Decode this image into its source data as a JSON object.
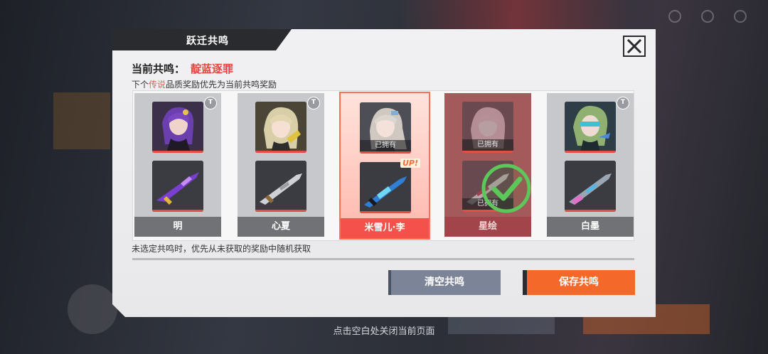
{
  "modal": {
    "title": "跃迁共鸣",
    "close_icon": "close-icon",
    "current_label": "当前共鸣：",
    "current_name": "靛蓝逐罪",
    "priority_prefix": "下个",
    "priority_legend": "传说",
    "priority_suffix": "品质奖励优先为当前共鸣奖励",
    "random_note": "未选定共鸣时，优先从未获取的奖励中随机获取",
    "clear_button": "清空共鸣",
    "save_button": "保存共鸣"
  },
  "cards": [
    {
      "name": "明",
      "badge": "T",
      "state": "default"
    },
    {
      "name": "心夏",
      "badge": "T",
      "state": "default"
    },
    {
      "name": "米雪儿·李",
      "badge": "",
      "state": "selected",
      "owned_tag": "已拥有",
      "up_tag": "UP!"
    },
    {
      "name": "星绘",
      "badge": "",
      "state": "owned",
      "owned_tag": "已拥有",
      "owned_tag_2": "已拥有"
    },
    {
      "name": "白墨",
      "badge": "T",
      "state": "default"
    }
  ],
  "footer_hint": "点击空白处关闭当前页面",
  "colors": {
    "accent_red": "#e3463e",
    "legend_orange": "#e0625a",
    "save_orange": "#f4682a",
    "clear_gray": "#7c8597",
    "check_green": "#5cc85a"
  }
}
